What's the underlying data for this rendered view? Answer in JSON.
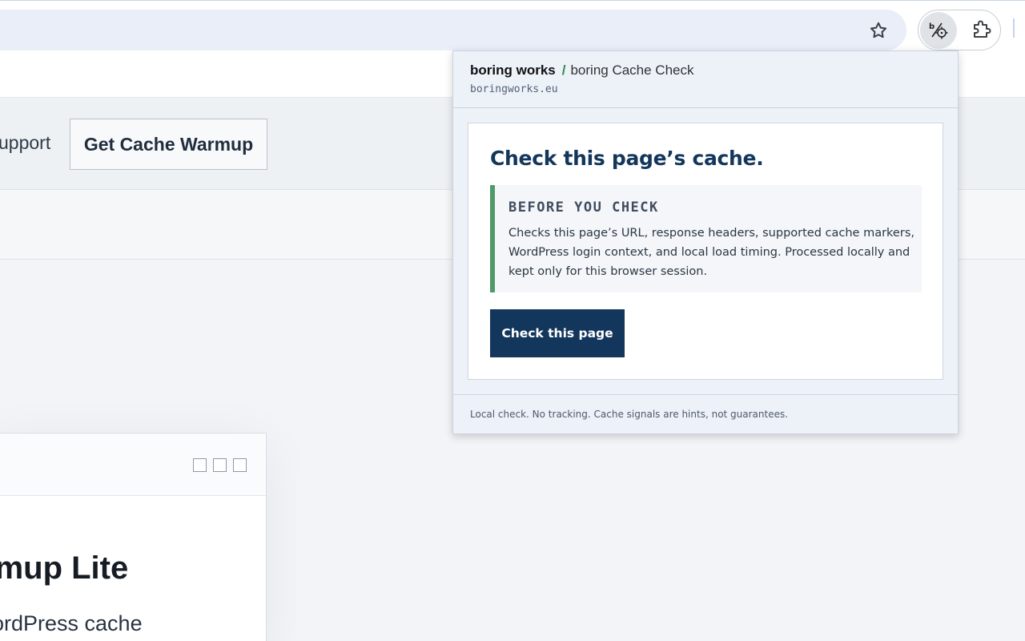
{
  "browser": {
    "bookmark_icon": "star-outline-icon",
    "extension_icon": "boring-cache-check-icon",
    "extensions_icon": "puzzle-piece-icon"
  },
  "site": {
    "nav_link": "upport",
    "cta_button": "Get Cache Warmup",
    "card_title": "rmup Lite",
    "card_text": "ordPress cache"
  },
  "popup": {
    "brand": "boring works",
    "separator": "/",
    "product": "boring Cache Check",
    "domain": "boringworks.eu",
    "title": "Check this page’s cache.",
    "notice_label": "BEFORE YOU CHECK",
    "notice_text": "Checks this page’s URL, response headers, supported cache markers, WordPress login context, and local load timing. Processed locally and kept only for this browser session.",
    "check_button": "Check this page",
    "footer": "Local check. No tracking. Cache signals are hints, not guarantees."
  },
  "colors": {
    "primary": "#12365c",
    "accent_green": "#4f9a69",
    "popup_bg": "#edf1f8"
  }
}
